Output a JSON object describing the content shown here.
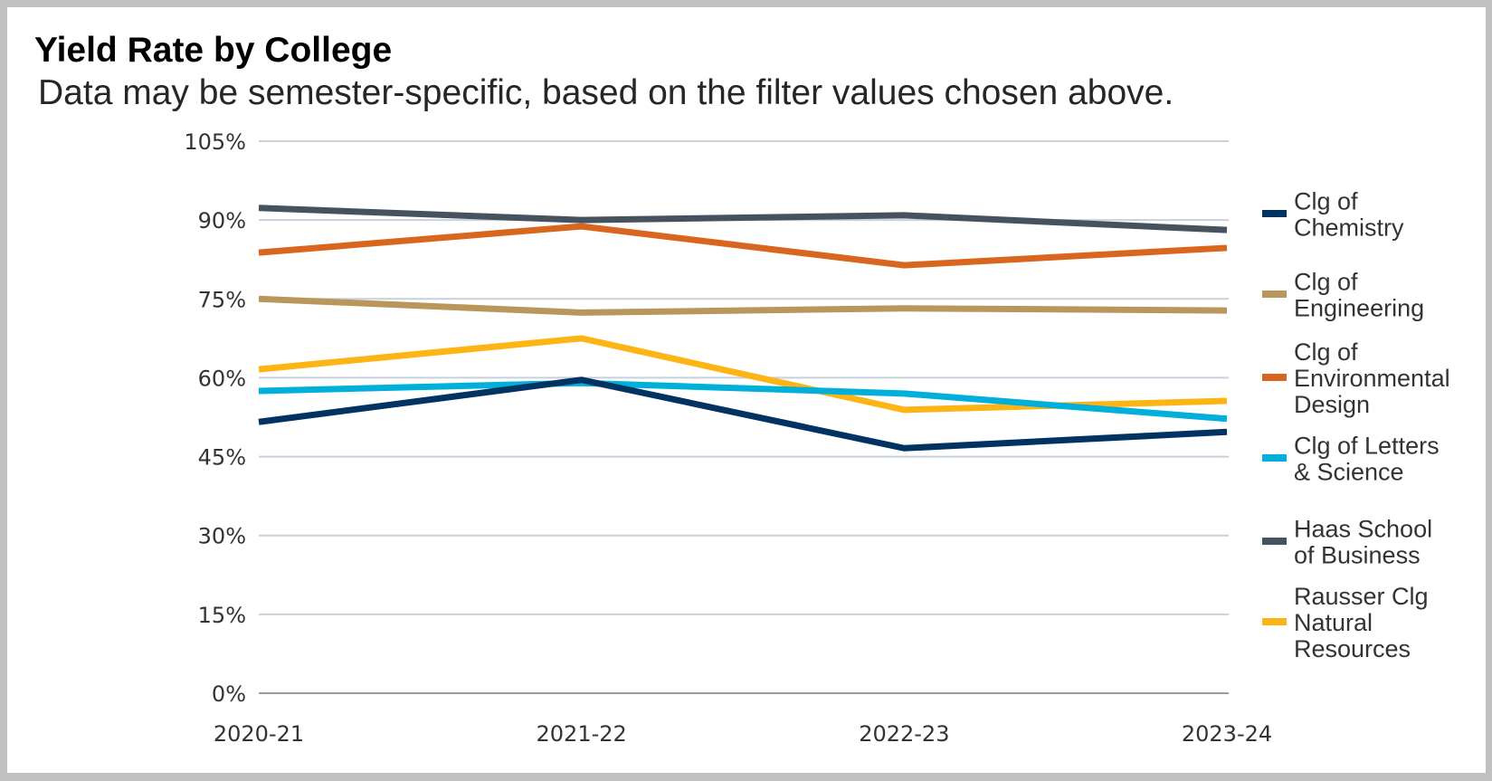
{
  "chart_data": {
    "type": "line",
    "title": "Yield Rate by College",
    "subtitle": "Data may be semester-specific, based on the filter values chosen above.",
    "xlabel": "",
    "ylabel": "",
    "categories": [
      "2020-21",
      "2021-22",
      "2022-23",
      "2023-24"
    ],
    "ylim": [
      0,
      105
    ],
    "yticks": [
      0,
      15,
      30,
      45,
      60,
      75,
      90,
      105
    ],
    "ytick_labels": [
      "0%",
      "15%",
      "30%",
      "45%",
      "60%",
      "75%",
      "90%",
      "105%"
    ],
    "grid": true,
    "legend_position": "right",
    "series": [
      {
        "name": "Clg of Chemistry",
        "legend_lines": [
          "Clg of",
          "Chemistry"
        ],
        "color": "#003262",
        "values": [
          51.6,
          59.6,
          46.6,
          49.7
        ]
      },
      {
        "name": "Clg of Engineering",
        "legend_lines": [
          "Clg of",
          "Engineering"
        ],
        "color": "#B9975B",
        "values": [
          75.0,
          72.4,
          73.2,
          72.8
        ]
      },
      {
        "name": "Clg of Environmental Design",
        "legend_lines": [
          "Clg of",
          "Environmental",
          "Design"
        ],
        "color": "#D9661F",
        "values": [
          83.8,
          88.8,
          81.4,
          84.7
        ]
      },
      {
        "name": "Clg of Letters & Science",
        "legend_lines": [
          "Clg of Letters",
          "& Science"
        ],
        "color": "#00B0DA",
        "values": [
          57.5,
          59.0,
          57.0,
          52.2
        ]
      },
      {
        "name": "Haas School of Business",
        "legend_lines": [
          "Haas School",
          "of Business"
        ],
        "color": "#46535E",
        "values": [
          92.3,
          90.0,
          90.9,
          88.1
        ]
      },
      {
        "name": "Rausser Clg Natural Resources",
        "legend_lines": [
          "Rausser Clg",
          "Natural",
          "Resources"
        ],
        "color": "#FDB515",
        "values": [
          61.6,
          67.5,
          53.9,
          55.6
        ]
      }
    ]
  }
}
